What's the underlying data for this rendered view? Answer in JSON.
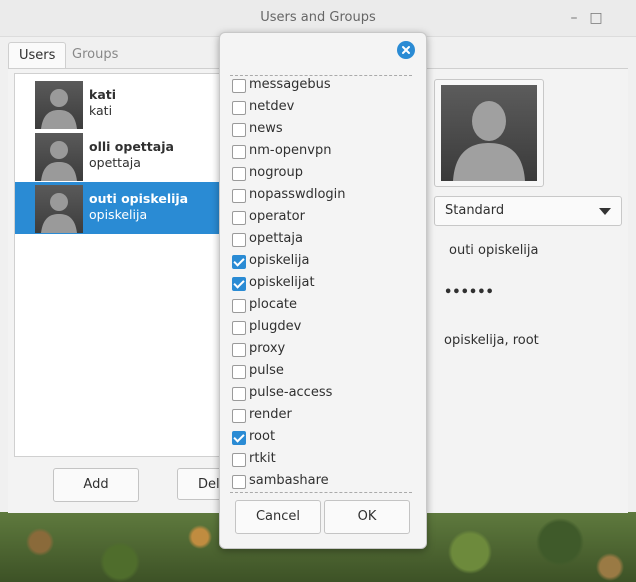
{
  "window": {
    "title": "Users and Groups",
    "minimize_glyph": "–",
    "maximize_glyph": "□"
  },
  "tabs": [
    {
      "label": "Users",
      "active": true
    },
    {
      "label": "Groups",
      "active": false
    }
  ],
  "users": [
    {
      "name": "kati",
      "login": "kati",
      "selected": false
    },
    {
      "name": "olli opettaja",
      "login": "opettaja",
      "selected": false
    },
    {
      "name": "outi opiskelija",
      "login": "opiskelija",
      "selected": true
    }
  ],
  "buttons": {
    "add": "Add",
    "delete_partial": "Del"
  },
  "details": {
    "account_type": "Standard",
    "full_name": "outi opiskelija",
    "password_mask": "••••••",
    "groups": "opiskelija, root"
  },
  "dialog": {
    "groups": [
      {
        "label": "messagebus",
        "checked": false
      },
      {
        "label": "netdev",
        "checked": false
      },
      {
        "label": "news",
        "checked": false
      },
      {
        "label": "nm-openvpn",
        "checked": false
      },
      {
        "label": "nogroup",
        "checked": false
      },
      {
        "label": "nopasswdlogin",
        "checked": false
      },
      {
        "label": "operator",
        "checked": false
      },
      {
        "label": "opettaja",
        "checked": false
      },
      {
        "label": "opiskelija",
        "checked": true
      },
      {
        "label": "opiskelijat",
        "checked": true
      },
      {
        "label": "plocate",
        "checked": false
      },
      {
        "label": "plugdev",
        "checked": false
      },
      {
        "label": "proxy",
        "checked": false
      },
      {
        "label": "pulse",
        "checked": false
      },
      {
        "label": "pulse-access",
        "checked": false
      },
      {
        "label": "render",
        "checked": false
      },
      {
        "label": "root",
        "checked": true
      },
      {
        "label": "rtkit",
        "checked": false
      },
      {
        "label": "sambashare",
        "checked": false
      }
    ],
    "cancel_label": "Cancel",
    "ok_label": "OK"
  },
  "colors": {
    "accent": "#2a8bd4"
  }
}
